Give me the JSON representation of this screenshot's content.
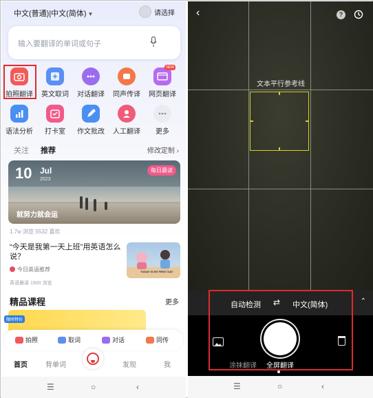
{
  "left": {
    "header": {
      "language_selector": "中文(普通)|中文(简体)",
      "user_label": "请选择"
    },
    "search": {
      "placeholder": "输入要翻译的单词或句子"
    },
    "tools": [
      {
        "label": "拍照翻译",
        "icon": "camera-icon",
        "color": "#f25a5a"
      },
      {
        "label": "英文取词",
        "icon": "pick-word-icon",
        "color": "#5b8ff2"
      },
      {
        "label": "对话翻译",
        "icon": "chat-icon",
        "color": "#9b6cf0"
      },
      {
        "label": "同声传译",
        "icon": "simultaneous-icon",
        "color": "#f2784a"
      },
      {
        "label": "网页翻译",
        "icon": "webpage-icon",
        "color": "#b56cf0",
        "badge": "NEW"
      },
      {
        "label": "语法分析",
        "icon": "grammar-icon",
        "color": "#4a8ff2"
      },
      {
        "label": "打卡室",
        "icon": "checkin-icon",
        "color": "#f25a8a"
      },
      {
        "label": "作文批改",
        "icon": "essay-icon",
        "color": "#4a8ff2"
      },
      {
        "label": "人工翻译",
        "icon": "human-translate-icon",
        "color": "#f25a7a"
      },
      {
        "label": "更多",
        "icon": "more-icon",
        "color": "#e8e8ee"
      }
    ],
    "feed_tabs": [
      "关注",
      "推荐"
    ],
    "custom_link": "修改定制 ›",
    "banner": {
      "day": "10",
      "month": "Jul",
      "year": "2023",
      "tag": "每日晨读",
      "slogan": "就努力就会运"
    },
    "banner_meta": "1.7w 浏览   5532 喜欢",
    "article": {
      "title": "“今天是我第一天上班”用英语怎么说？",
      "source": "今日英语推荐",
      "meta": "英语晨读   1900 浏览",
      "thumb_caption": "TODAY IS MY FIRST DAY"
    },
    "courses": {
      "title": "精品课程",
      "more": "更多",
      "tag": "限时特价"
    },
    "quick_actions": [
      "拍照",
      "取词",
      "对话",
      "同传"
    ],
    "tabbar": [
      "首页",
      "背单词",
      "发现",
      "我"
    ],
    "system_nav": [
      "☰",
      "○",
      "‹"
    ]
  },
  "right": {
    "hint": "文本平行参考线",
    "source_language": "自动检测",
    "swap": "⇄",
    "target_language": "中文(简体)",
    "collapse": "⌃",
    "help": "?",
    "modes": [
      "涂抹翻译",
      "全屏翻译"
    ],
    "system_nav": [
      "☰",
      "○",
      "‹"
    ]
  },
  "colors": {
    "highlight": "#e02b2b",
    "frame": "#d6d02a",
    "accent": "#e0353b"
  }
}
